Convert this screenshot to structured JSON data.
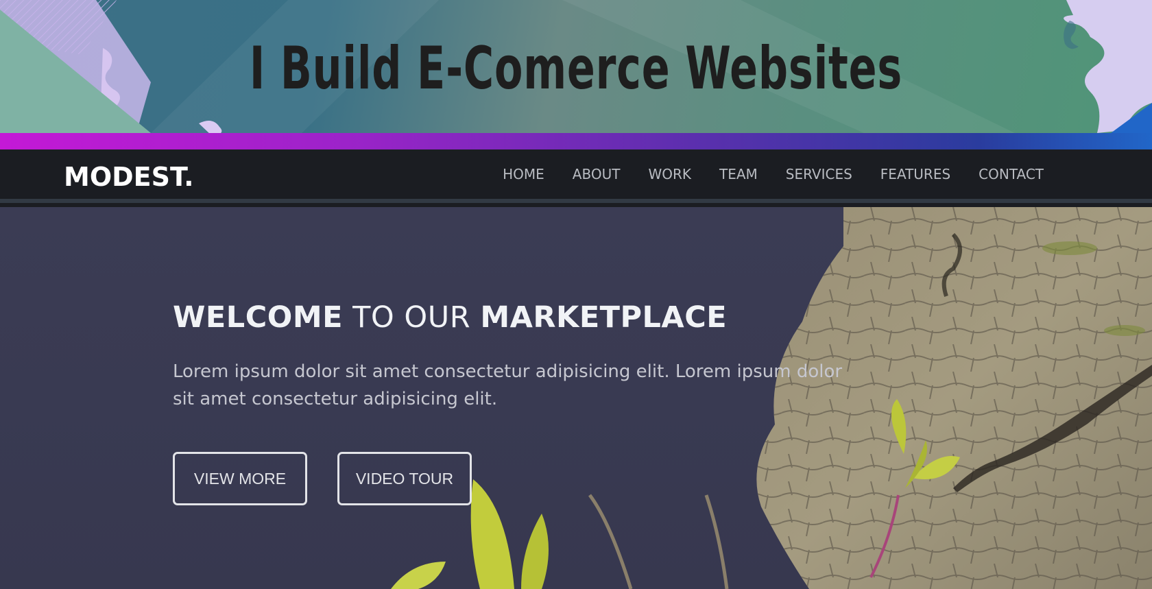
{
  "banner": {
    "title": "I Build E-Comerce Websites",
    "colors": {
      "gradient_start": "#3c6f86",
      "gradient_end": "#4f9577",
      "stripe": "#c419d6"
    }
  },
  "navbar": {
    "logo": "MODEST.",
    "items": [
      {
        "label": "HOME"
      },
      {
        "label": "ABOUT"
      },
      {
        "label": "WORK"
      },
      {
        "label": "TEAM"
      },
      {
        "label": "SERVICES"
      },
      {
        "label": "FEATURES"
      },
      {
        "label": "CONTACT"
      }
    ]
  },
  "hero": {
    "title_part1": "WELCOME",
    "title_part2": " TO OUR ",
    "title_part3": "MARKETPLACE",
    "text": "Lorem ipsum dolor sit amet consectetur adipisicing elit. Lorem ipsum dolor sit amet consectetur adipisicing elit.",
    "buttons": {
      "view_more": "VIEW MORE",
      "video_tour": "VIDEO TOUR"
    }
  }
}
